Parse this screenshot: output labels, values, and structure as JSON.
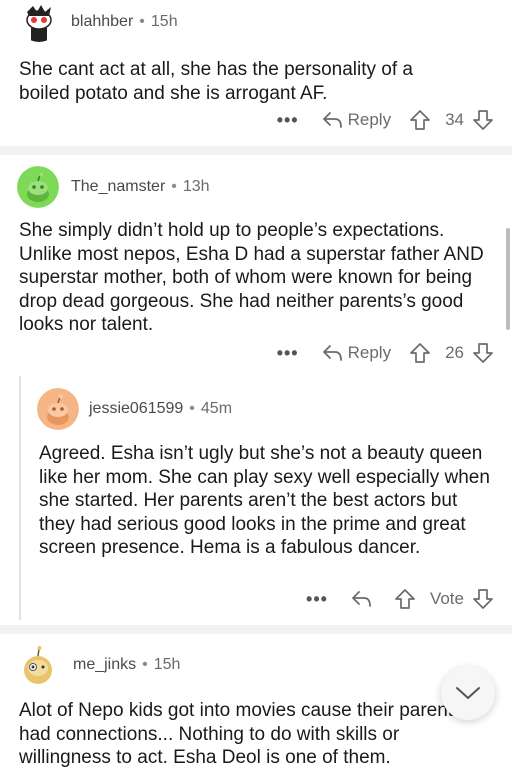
{
  "comments": [
    {
      "username": "blahhber",
      "separator": "•",
      "time": "15h",
      "body": "She cant act at all, she has the personality of a boiled potato and she is arrogant AF.",
      "more": "•••",
      "reply_label": "Reply",
      "score": "34"
    },
    {
      "username": "The_namster",
      "separator": "•",
      "time": "13h",
      "body": "She simply didn’t hold up to people’s expectations. Unlike most nepos, Esha D had a superstar father AND superstar mother, both of whom were known for being drop dead gorgeous. She had neither parents’s good looks nor talent.",
      "more": "•••",
      "reply_label": "Reply",
      "score": "26"
    },
    {
      "username": "jessie061599",
      "separator": "•",
      "time": "45m",
      "body": "Agreed. Esha isn’t ugly but she’s not a beauty queen like her mom. She can play sexy well especially when she started. Her parents aren’t the best actors but they had serious good looks in the prime and great screen presence. Hema is a fabulous dancer.",
      "more": "•••",
      "vote_label": "Vote"
    },
    {
      "username": "me_jinks",
      "separator": "•",
      "time": "15h",
      "body": "Alot of Nepo kids got into movies cause their parents had connections... Nothing to do with skills or willingness to act. Esha Deol is one of them."
    }
  ],
  "colors": {
    "avatar_green": "#7ed957",
    "avatar_orange": "#f6b585",
    "avatar_yellow": "#e9c46a",
    "icon_gray": "#6b6b6e"
  },
  "icons": [
    "reply-arrow-icon",
    "upvote-icon",
    "downvote-icon",
    "more-dots-icon",
    "chevron-down-icon"
  ]
}
